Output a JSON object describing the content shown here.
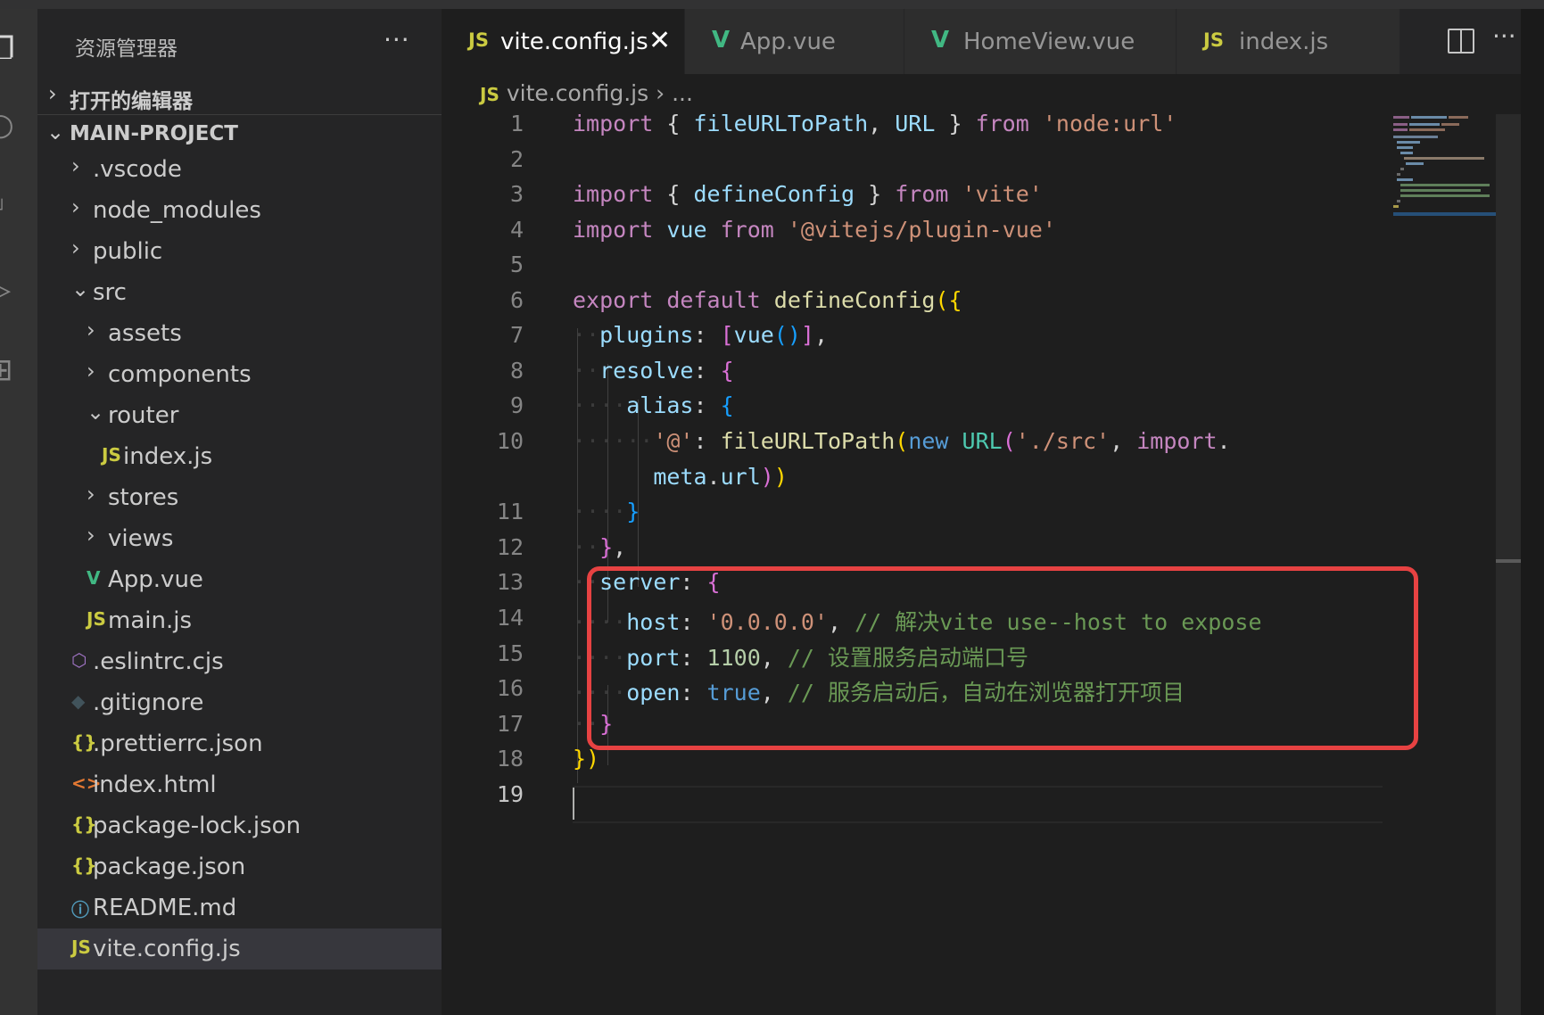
{
  "sidebar": {
    "title": "资源管理器",
    "more": "···",
    "sections": {
      "open_editors": "打开的编辑器",
      "project": "MAIN-PROJECT"
    },
    "tree": [
      {
        "label": ".vscode",
        "icon": "chevron-right"
      },
      {
        "label": "node_modules",
        "icon": "chevron-right"
      },
      {
        "label": "public",
        "icon": "chevron-right"
      },
      {
        "label": "src",
        "icon": "chevron-down"
      },
      {
        "label": "assets",
        "icon": "chevron-right"
      },
      {
        "label": "components",
        "icon": "chevron-right"
      },
      {
        "label": "router",
        "icon": "chevron-down"
      },
      {
        "label": "index.js",
        "icon": "js-file"
      },
      {
        "label": "stores",
        "icon": "chevron-right"
      },
      {
        "label": "views",
        "icon": "chevron-right"
      },
      {
        "label": "App.vue",
        "icon": "vue-file"
      },
      {
        "label": "main.js",
        "icon": "js-file"
      },
      {
        "label": ".eslintrc.cjs",
        "icon": "eslint-file"
      },
      {
        "label": ".gitignore",
        "icon": "git-file"
      },
      {
        "label": ".prettierrc.json",
        "icon": "json-file"
      },
      {
        "label": "index.html",
        "icon": "html-file"
      },
      {
        "label": "package-lock.json",
        "icon": "json-file"
      },
      {
        "label": "package.json",
        "icon": "json-file"
      },
      {
        "label": "README.md",
        "icon": "info-file"
      },
      {
        "label": "vite.config.js",
        "icon": "js-file",
        "selected": true
      }
    ]
  },
  "tabs": [
    {
      "label": "vite.config.js",
      "icon": "JS",
      "active": true
    },
    {
      "label": "App.vue",
      "icon": "V"
    },
    {
      "label": "HomeView.vue",
      "icon": "V"
    },
    {
      "label": "index.js",
      "icon": "JS"
    }
  ],
  "tab_close": "✕",
  "tab_more": "···",
  "breadcrumb": {
    "icon": "JS",
    "file": "vite.config.js",
    "sep": "›",
    "rest": "..."
  },
  "icon_text": {
    "js": "JS",
    "vue": "V",
    "json": "{}",
    "html": "<>",
    "info": "ⓘ",
    "eslint": "⬡",
    "git": "◆"
  },
  "editor": {
    "line_numbers": [
      "1",
      "2",
      "3",
      "4",
      "5",
      "6",
      "7",
      "8",
      "9",
      "10",
      "",
      "11",
      "12",
      "13",
      "14",
      "15",
      "16",
      "17",
      "18",
      "19"
    ],
    "code": {
      "l1": {
        "kw": "import",
        "p1": " { ",
        "id1": "fileURLToPath",
        "p2": ", ",
        "id2": "URL",
        "p3": " } ",
        "from": "from",
        "str": "'node:url'"
      },
      "l3": {
        "kw": "import",
        "p1": " { ",
        "id1": "defineConfig",
        "p2": " } ",
        "from": "from",
        "str": "'vite'"
      },
      "l4": {
        "kw": "import",
        "id1": "vue",
        "from": "from",
        "str": "'@vitejs/plugin-vue'"
      },
      "l6": {
        "kw": "export",
        "kw2": "default",
        "fn": "defineConfig",
        "open": "({"
      },
      "l7": {
        "key": "plugins",
        "val": "vue"
      },
      "l8": {
        "key": "resolve"
      },
      "l9": {
        "key": "alias"
      },
      "l10": {
        "str": "'@'",
        "fn": "fileURLToPath",
        "new": "new",
        "cls": "URL",
        "str2": "'./src'",
        "imp": "import",
        "dot": "."
      },
      "l10b": {
        "meta": "meta",
        "dot": ".",
        "url": "url"
      },
      "l13": {
        "key": "server"
      },
      "l14": {
        "key": "host",
        "str": "'0.0.0.0'",
        "comment": "// 解决vite use--host to expose"
      },
      "l15": {
        "key": "port",
        "num": "1100",
        "comment": "// 设置服务启动端口号"
      },
      "l16": {
        "key": "open",
        "bool": "true",
        "comment": "// 服务启动后，自动在浏览器打开项目"
      }
    }
  }
}
